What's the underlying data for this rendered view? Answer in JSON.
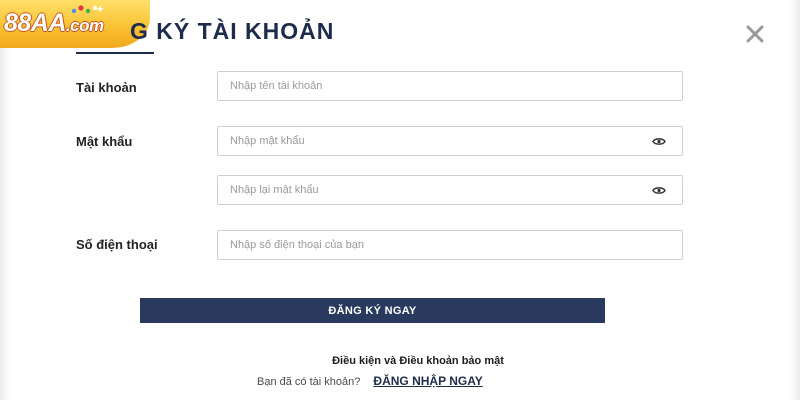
{
  "brand": {
    "logo_name": "88AA",
    "logo_suffix": ".com",
    "colors": {
      "logo_yellow": "#f9c233",
      "logo_outline": "#c6521b"
    }
  },
  "header": {
    "title": "G KÝ TÀI KHOẢN",
    "close_icon": "close-icon"
  },
  "form": {
    "account": {
      "label": "Tài khoản",
      "placeholder": "Nhập tên tài khoản",
      "value": ""
    },
    "password": {
      "label": "Mật khẩu",
      "placeholder": "Nhập mật khẩu",
      "confirm_placeholder": "Nhập lại mật khẩu",
      "icon": "eye-icon"
    },
    "phone": {
      "label": "Số điện thoại",
      "placeholder": "Nhập số điện thoại của bạn",
      "value": ""
    },
    "submit_label": "ĐĂNG KÝ NGAY"
  },
  "footer": {
    "terms_text": "Điều kiện và Điều khoản bảo mật",
    "have_account_text": "Bạn đã có tài khoản?",
    "login_link": "ĐĂNG NHẬP NGAY"
  },
  "colors": {
    "primary": "#2a3a5f",
    "title": "#1d2c4d",
    "input_border": "#cfcfcf",
    "placeholder": "#9a9a9a"
  }
}
